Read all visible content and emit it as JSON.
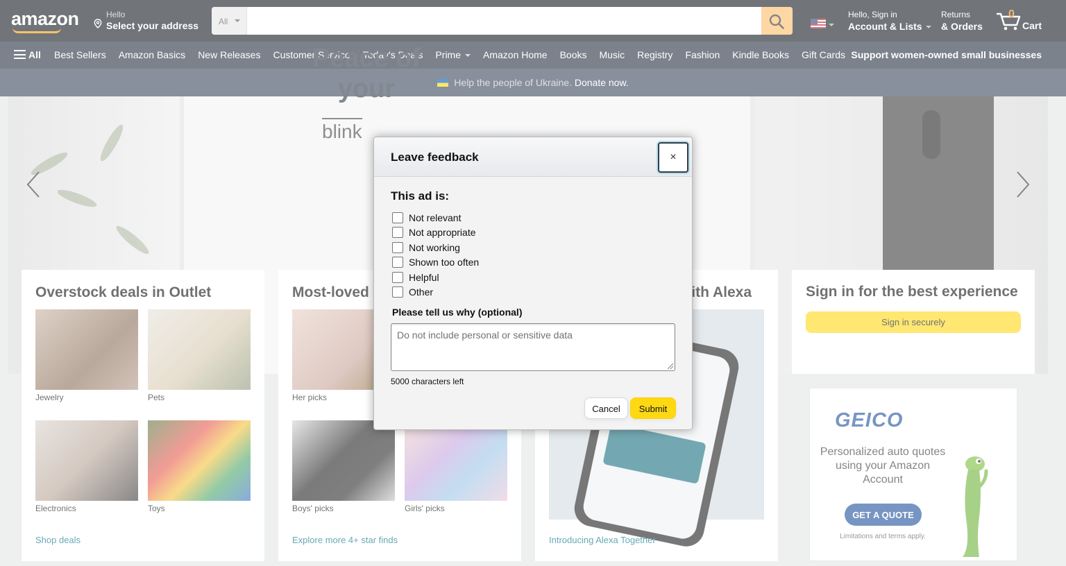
{
  "header": {
    "logo": "amazon",
    "address_hello": "Hello",
    "address_select": "Select your address",
    "search_category": "All",
    "search_placeholder": "",
    "account_line1": "Hello, Sign in",
    "account_line2": "Account & Lists",
    "returns_line1": "Returns",
    "returns_line2": "& Orders",
    "cart_count": "0",
    "cart_label": "Cart"
  },
  "nav": {
    "all_label": "All",
    "links": [
      "Best Sellers",
      "Amazon Basics",
      "New Releases",
      "Customer Service",
      "Today's Deals",
      "Prime",
      "Amazon Home",
      "Books",
      "Music",
      "Registry",
      "Fashion",
      "Kindle Books",
      "Gift Cards"
    ],
    "promo": "Support women-owned small businesses"
  },
  "ukraine_banner": {
    "text": "Help the people of Ukraine.",
    "link": "Donate now."
  },
  "hero": {
    "title_line1": "Peace of",
    "title_line2": "your",
    "brand": "blink"
  },
  "cards": {
    "outlet": {
      "title": "Overstock deals in Outlet",
      "tiles": [
        "Jewelry",
        "Pets",
        "Electronics",
        "Toys"
      ],
      "link": "Shop deals"
    },
    "loved": {
      "title": "Most-loved",
      "tiles": [
        "Her picks",
        "Boys' picks",
        "Girls' picks"
      ],
      "link": "Explore more 4+ star finds"
    },
    "alexa": {
      "title": "ith Alexa",
      "link": "Introducing Alexa Together"
    }
  },
  "signin": {
    "title": "Sign in for the best experience",
    "button": "Sign in securely"
  },
  "ad": {
    "brand": "GEICO",
    "tagline": "Personalized auto quotes using your Amazon Account",
    "cta": "GET A QUOTE",
    "fine_print": "Limitations and terms apply."
  },
  "modal": {
    "title": "Leave feedback",
    "close": "×",
    "question": "This ad is:",
    "options": [
      "Not relevant",
      "Not appropriate",
      "Not working",
      "Shown too often",
      "Helpful",
      "Other"
    ],
    "why_label": "Please tell us why (optional)",
    "textarea_placeholder": "Do not include personal or sensitive data",
    "chars_left": "5000 characters left",
    "cancel": "Cancel",
    "submit": "Submit"
  },
  "colors": {
    "header_bg": "#131921",
    "nav_bg": "#232f3e",
    "search_button": "#febd69",
    "primary_button": "#ffd814",
    "link": "#007185",
    "cart_count": "#f08804"
  }
}
